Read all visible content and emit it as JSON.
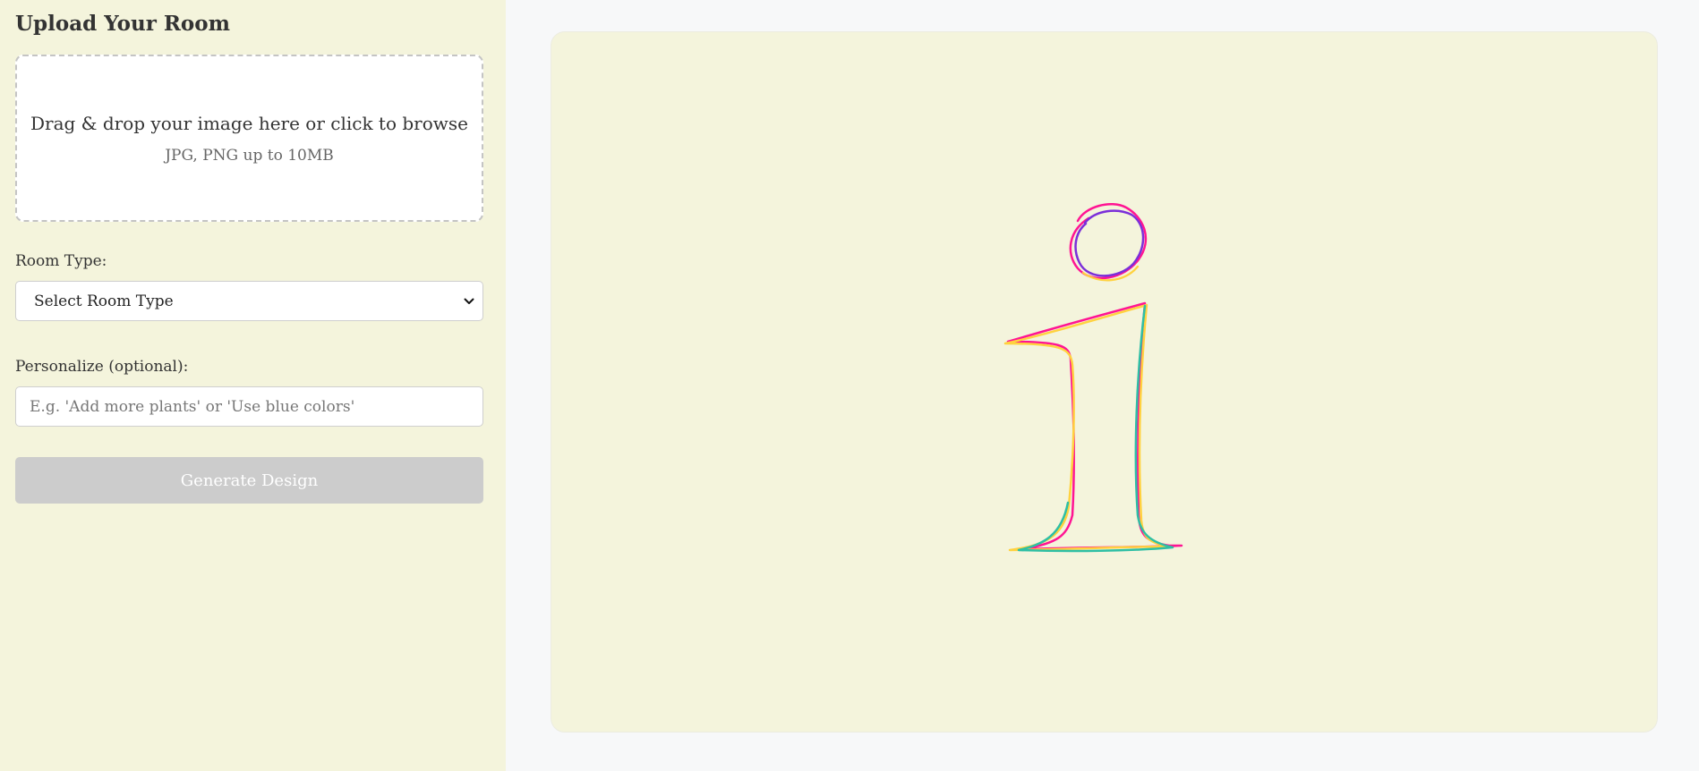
{
  "sidebar": {
    "title": "Upload Your Room",
    "dropzone": {
      "main_text": "Drag & drop your image here or click to browse",
      "sub_text": "JPG, PNG up to 10MB"
    },
    "room_type": {
      "label": "Room Type:",
      "selected": "Select Room Type"
    },
    "personalize": {
      "label": "Personalize (optional):",
      "placeholder": "E.g. 'Add more plants' or 'Use blue colors'"
    },
    "generate_button": "Generate Design"
  },
  "preview": {
    "icon": "info-icon",
    "icon_colors": [
      "#ff1493",
      "#ffd23f",
      "#2ebfa5",
      "#7b2fd9"
    ]
  },
  "colors": {
    "sidebar_bg": "#f4f4dc",
    "button_disabled": "#cccccc"
  }
}
